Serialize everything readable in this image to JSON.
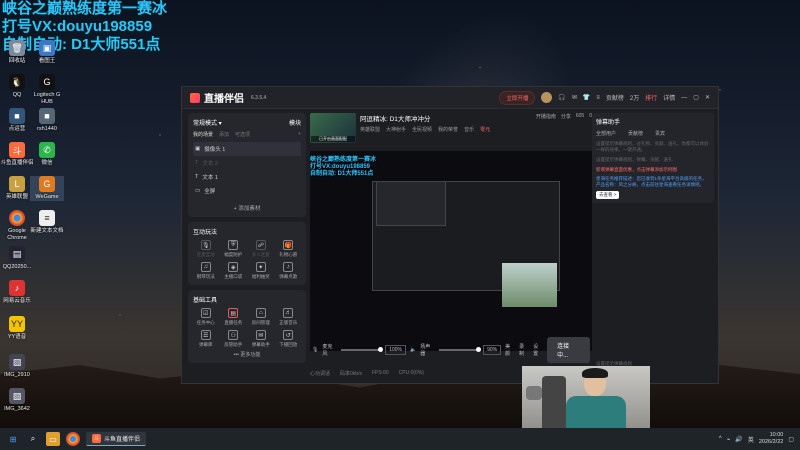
{
  "overlay": {
    "line1": "峡谷之巅熟练度第一赛冰",
    "line2": "打号VX:douyu198859",
    "line3": "自制自动: D1大师551点"
  },
  "desktop_icons": [
    {
      "label": "回收站",
      "icon": "recycle-bin-icon"
    },
    {
      "label": "看图王",
      "icon": "image-viewer-icon"
    },
    {
      "label": "QQ",
      "icon": "qq-icon"
    },
    {
      "label": "Logitech G HUB",
      "icon": "logitech-icon"
    },
    {
      "label": "点运营",
      "icon": "app-icon"
    },
    {
      "label": "rsh1440",
      "icon": "app-icon"
    },
    {
      "label": "斗鱼直播伴侣",
      "icon": "douyu-icon"
    },
    {
      "label": "微信",
      "icon": "wechat-icon"
    },
    {
      "label": "英雄联盟",
      "icon": "lol-icon"
    },
    {
      "label": "WeGame",
      "icon": "wegame-icon"
    },
    {
      "label": "Google Chrome",
      "icon": "chrome-icon"
    },
    {
      "label": "新建文本文档",
      "icon": "text-file-icon"
    },
    {
      "label": "QQ20250...",
      "icon": "file-icon"
    },
    {
      "label": "网易云音乐",
      "icon": "netease-music-icon"
    },
    {
      "label": "YY语音",
      "icon": "yy-icon"
    },
    {
      "label": "IMG_2910",
      "icon": "image-file-icon"
    },
    {
      "label": "IMG_3642",
      "icon": "image-file-icon"
    }
  ],
  "app": {
    "name": "直播伴侣",
    "version": "6.3.5.4",
    "start_live": "立即开播",
    "right_titlebar": [
      "贡献榜",
      "2万",
      "排行",
      "详情"
    ]
  },
  "scene_panel": {
    "mode": "常规模式",
    "guide": "模块",
    "tabs": [
      "我的场景",
      "添加",
      "可选项"
    ],
    "sources": [
      {
        "name": "摄像头 1",
        "state": "selected"
      },
      {
        "name": "文本 2",
        "state": "dim"
      },
      {
        "name": "文本 1",
        "state": "normal"
      },
      {
        "name": "全屏",
        "state": "normal"
      }
    ],
    "add_source": "+ 添加素材"
  },
  "interact_panel": {
    "title": "互动玩法",
    "tools": [
      {
        "label": "连麦互动",
        "dim": true
      },
      {
        "label": "幅度防护",
        "dim": false
      },
      {
        "label": "多人连麦",
        "dim": true
      },
      {
        "label": "礼物心愿",
        "dim": false
      },
      {
        "label": "钢琴玩法",
        "dim": false
      },
      {
        "label": "主播口袋",
        "dim": false
      },
      {
        "label": "福利抽奖",
        "dim": false
      },
      {
        "label": "弹幕点歌",
        "dim": false
      }
    ]
  },
  "basic_tools": {
    "title": "基础工具",
    "tools": [
      "任务中心",
      "直播任务",
      "房间管理",
      "正版音乐",
      "弹幕库",
      "房管助手",
      "弹幕助手",
      "下播回放"
    ],
    "more": "••• 更多功能"
  },
  "room": {
    "thumb_label": "已开启画面配配",
    "title": "阿逗精冰: D1大师冲冲分",
    "meta": [
      "英雄联盟",
      "大神射手",
      "全民视频",
      "我的荣誉",
      "音乐"
    ],
    "badge": "零元",
    "right_meta": [
      "开播指南",
      "分享",
      "605",
      "0"
    ]
  },
  "preview_overlay": {
    "line1": "峡谷之巅熟练度第一赛冰",
    "line2": "打号VX:douyu198859",
    "line3": "自制自动: D1大师551点"
  },
  "controls": {
    "mic_label": "麦克风",
    "mic_pct": "100%",
    "speaker_label": "扬声器",
    "speaker_pct": "90%",
    "beauty": "美颜",
    "record": "录制",
    "settings": "设置",
    "connect": "连接中..."
  },
  "status_bar": [
    "心功调适",
    "码率0kb/s",
    "FPS:60",
    "CPU:0(0%)"
  ],
  "right_panel": {
    "tabs": [
      "贡献榜",
      "全部用户",
      "贵宾"
    ],
    "assistant_title": "弹幕助手",
    "sub_tabs": [
      "全部用户",
      "贡献榜",
      "贵宾"
    ],
    "hint": "设置提示弹幕规则，过礼物、贡献、送礼，你都可以体验一样的效果，一键开通。",
    "hint2": "设置提示弹幕规则，弹幕、贡献、送礼",
    "red": "新增弹幕直面优惠，点击弹幕添加示例图",
    "ai": "星海任务推荐描述：您已收到1条星海平台高级的任务，产品名称：风之分峡，点击前往星海查看任务详情吧。",
    "try_btn": "去查看 >",
    "bottom_hint": "设置提示弹幕规则"
  },
  "taskbar": {
    "app": "斗鱼直播伴侣",
    "lang": "英",
    "time": "10:00",
    "date": "2026/2/22"
  }
}
